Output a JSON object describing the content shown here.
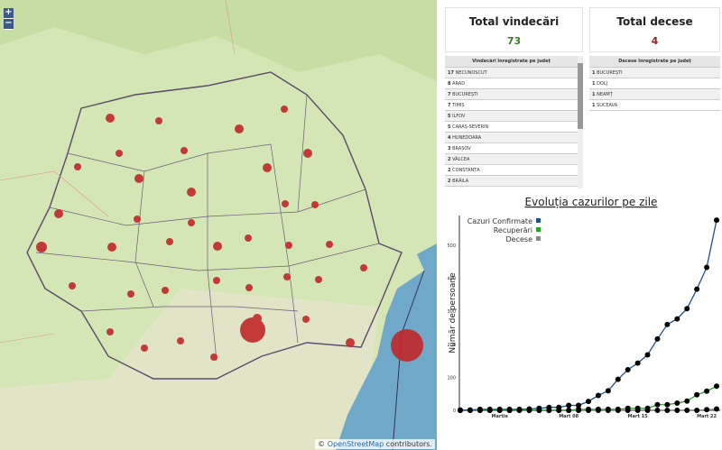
{
  "map": {
    "zoom_in": "+",
    "zoom_out": "−",
    "attribution_prefix": "©",
    "attribution_link": "OpenStreetMap",
    "attribution_suffix": " contributors.",
    "sea_color": "#6fa8c8",
    "marker_color": "#c0282a"
  },
  "recoveries": {
    "title": "Total vindecări",
    "value": "73",
    "value_color": "#3a7a2a",
    "table_header": "Vindecări înregistrate pe județ",
    "rows": [
      {
        "n": "17",
        "name": "NECUNOSCUT"
      },
      {
        "n": "8",
        "name": "ARAD"
      },
      {
        "n": "7",
        "name": "BUCUREȘTI"
      },
      {
        "n": "7",
        "name": "TIMIȘ"
      },
      {
        "n": "5",
        "name": "ILFOV"
      },
      {
        "n": "5",
        "name": "CARAȘ-SEVERIN"
      },
      {
        "n": "4",
        "name": "HUNEDOARA"
      },
      {
        "n": "3",
        "name": "BRAȘOV"
      },
      {
        "n": "2",
        "name": "VÂLCEA"
      },
      {
        "n": "2",
        "name": "CONSTANȚA"
      },
      {
        "n": "2",
        "name": "BRĂILA"
      }
    ]
  },
  "deaths": {
    "title": "Total decese",
    "value": "4",
    "value_color": "#8a2a2a",
    "table_header": "Decese înregistrate pe județ",
    "rows": [
      {
        "n": "1",
        "name": "BUCUREȘTI"
      },
      {
        "n": "1",
        "name": "DOLJ"
      },
      {
        "n": "1",
        "name": "NEAMȚ"
      },
      {
        "n": "1",
        "name": "SUCEAVA"
      }
    ]
  },
  "chart_data": {
    "type": "line",
    "title": "Evoluția cazurilor pe zile",
    "ylabel": "Număr de persoane",
    "xlabel": "",
    "x": [
      "2020-02-26",
      "2020-02-27",
      "2020-02-28",
      "2020-02-29",
      "2020-03-01",
      "2020-03-02",
      "2020-03-03",
      "2020-03-04",
      "2020-03-05",
      "2020-03-06",
      "2020-03-07",
      "2020-03-08",
      "2020-03-09",
      "2020-03-10",
      "2020-03-11",
      "2020-03-12",
      "2020-03-13",
      "2020-03-14",
      "2020-03-15",
      "2020-03-16",
      "2020-03-17",
      "2020-03-18",
      "2020-03-19",
      "2020-03-20",
      "2020-03-21",
      "2020-03-22",
      "2020-03-23"
    ],
    "xticks": [
      {
        "date": "2020-03-01",
        "label": "Martie"
      },
      {
        "date": "2020-03-08",
        "label": "Mart 08"
      },
      {
        "date": "2020-03-15",
        "label": "Mart 15"
      },
      {
        "date": "2020-03-22",
        "label": "Mart 22"
      }
    ],
    "yticks": [
      0,
      100,
      200,
      300,
      400,
      500
    ],
    "ylim": [
      0,
      590
    ],
    "legend_placement": "top-left",
    "series": [
      {
        "name": "Cazuri Confirmate",
        "color": "#1f4e8c",
        "values": [
          1,
          1,
          3,
          3,
          3,
          3,
          3,
          4,
          6,
          9,
          9,
          15,
          15,
          27,
          45,
          59,
          94,
          123,
          143,
          168,
          216,
          260,
          277,
          308,
          367,
          433,
          576
        ]
      },
      {
        "name": "Recuperări",
        "color": "#2ca02c",
        "values": [
          0,
          0,
          0,
          0,
          0,
          0,
          0,
          0,
          0,
          0,
          0,
          0,
          3,
          3,
          3,
          3,
          3,
          6,
          6,
          6,
          17,
          17,
          22,
          28,
          47,
          58,
          73
        ]
      },
      {
        "name": "Decese",
        "color": "#888888",
        "values": [
          0,
          0,
          0,
          0,
          0,
          0,
          0,
          0,
          0,
          0,
          0,
          0,
          0,
          0,
          0,
          0,
          0,
          0,
          0,
          0,
          0,
          0,
          0,
          0,
          0,
          2,
          4
        ]
      }
    ]
  }
}
